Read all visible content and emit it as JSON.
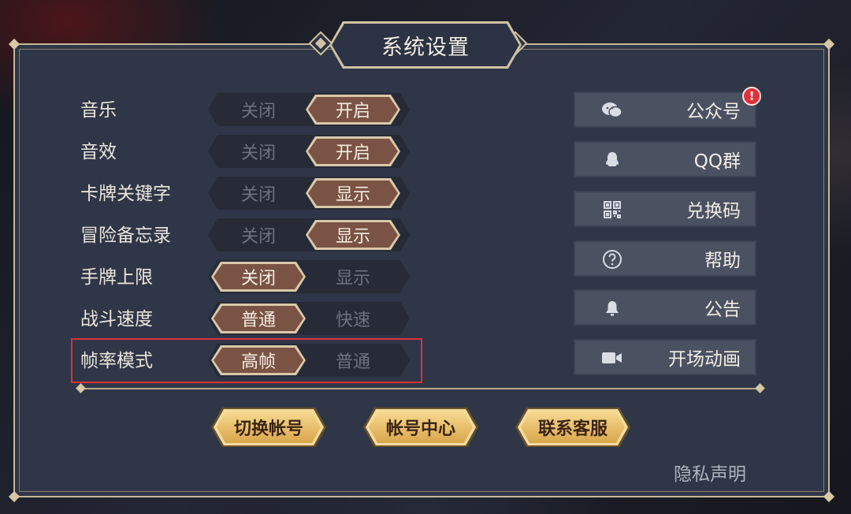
{
  "title": "系统设置",
  "settings": [
    {
      "label": "音乐",
      "left": "关闭",
      "right": "开启",
      "active": "right"
    },
    {
      "label": "音效",
      "left": "关闭",
      "right": "开启",
      "active": "right"
    },
    {
      "label": "卡牌关键字",
      "left": "关闭",
      "right": "显示",
      "active": "right"
    },
    {
      "label": "冒险备忘录",
      "left": "关闭",
      "right": "显示",
      "active": "right"
    },
    {
      "label": "手牌上限",
      "left": "关闭",
      "right": "显示",
      "active": "left"
    },
    {
      "label": "战斗速度",
      "left": "普通",
      "right": "快速",
      "active": "left"
    },
    {
      "label": "帧率模式",
      "left": "高帧",
      "right": "普通",
      "active": "left"
    }
  ],
  "side_buttons": [
    {
      "label": "公众号",
      "icon": "wechat-icon"
    },
    {
      "label": "QQ群",
      "icon": "qq-icon"
    },
    {
      "label": "兑换码",
      "icon": "qr-code-icon"
    },
    {
      "label": "帮助",
      "icon": "help-icon"
    },
    {
      "label": "公告",
      "icon": "bell-icon"
    },
    {
      "label": "开场动画",
      "icon": "video-camera-icon"
    }
  ],
  "notification_badge": "!",
  "account_buttons": [
    "切换帐号",
    "帐号中心",
    "联系客服"
  ],
  "privacy_link": "隐私声明",
  "colors": {
    "panel": "#2f3647",
    "border": "#c9b89a",
    "active_toggle": "#7a5344",
    "gold_button": "#e7bd6e",
    "highlight": "#e0303a"
  }
}
